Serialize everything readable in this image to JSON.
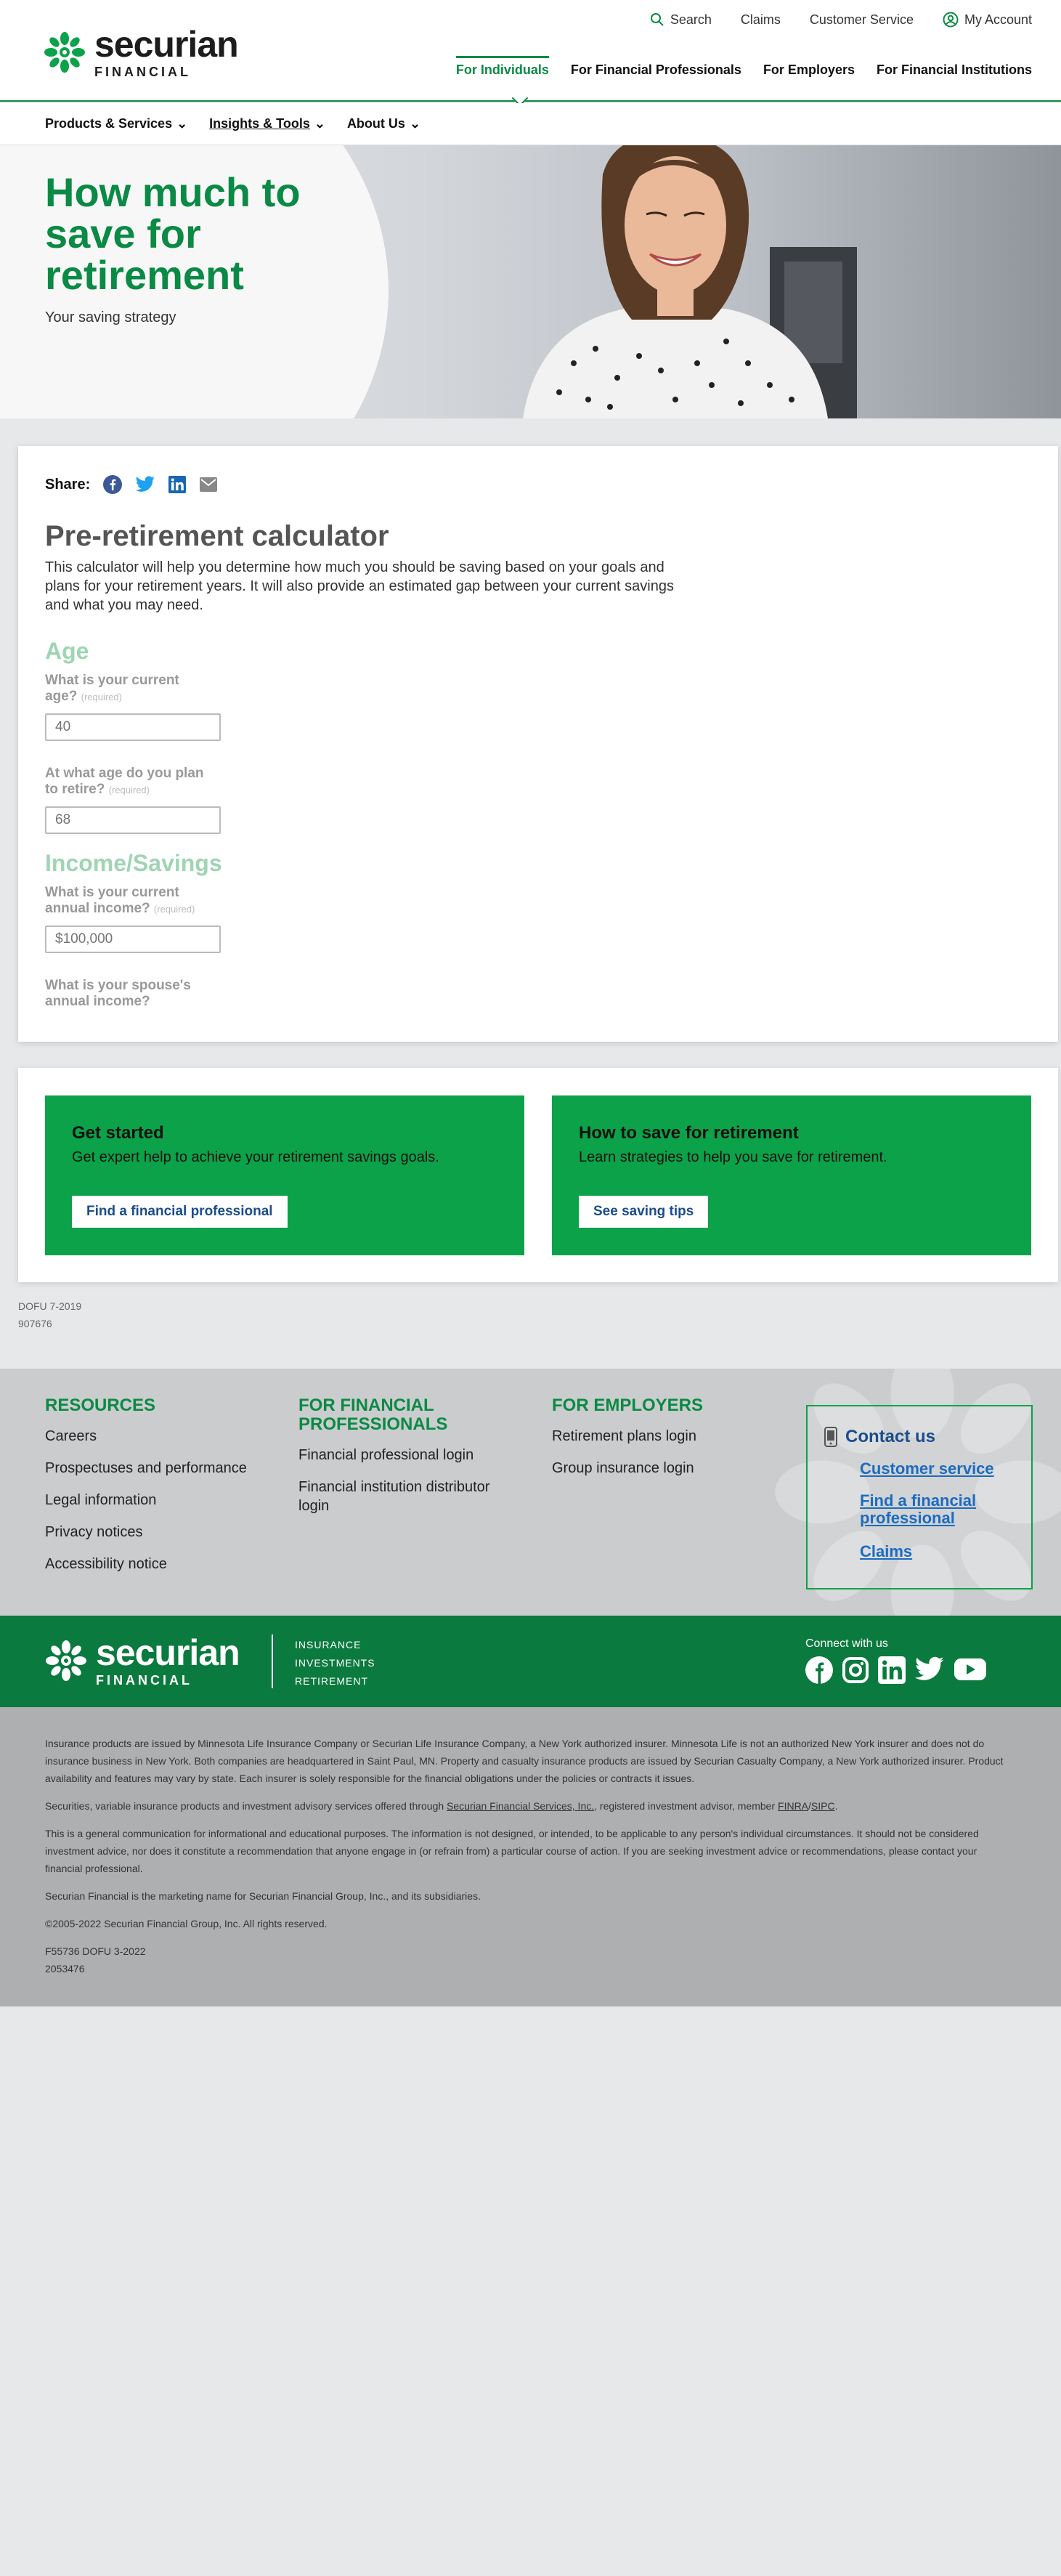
{
  "header": {
    "logo_main": "securian",
    "logo_sub": "FINANCIAL",
    "util_nav": [
      "Search",
      "Claims",
      "Customer Service",
      "My Account"
    ],
    "audience_nav": [
      "For Individuals",
      "For Financial Professionals",
      "For Employers",
      "For Financial Institutions"
    ],
    "sub_nav": [
      "Products & Services",
      "Insights & Tools",
      "About Us"
    ]
  },
  "hero": {
    "title": "How much to save for retirement",
    "subtitle": "Your saving strategy"
  },
  "calculator": {
    "share_label": "Share:",
    "share_icons": [
      "facebook-icon",
      "twitter-icon",
      "linkedin-icon",
      "email-icon"
    ],
    "title": "Pre-retirement calculator",
    "description": "This calculator will help you determine how much you should be saving based on your goals and plans for your retirement years. It will also provide an estimated gap between your current savings and what you may need.",
    "section_age": "Age",
    "q_current_age": "What is your current age?",
    "q_retire_age": "At what age do you plan to retire?",
    "required": "(required)",
    "current_age_placeholder": "40",
    "retire_age_placeholder": "68",
    "section_income": "Income/Savings",
    "q_income": "What is your current annual income?",
    "income_placeholder": "$100,000",
    "q_spouse_income": "What is your spouse's annual income?"
  },
  "cta": [
    {
      "title": "Get started",
      "text": "Get expert help to achieve your retirement savings goals.",
      "button": "Find a financial professional"
    },
    {
      "title": "How to save for retirement",
      "text": "Learn strategies to help you save for retirement.",
      "button": "See saving tips"
    }
  ],
  "codes": [
    "DOFU 7-2019",
    "907676"
  ],
  "footer": {
    "resources_title": "RESOURCES",
    "resources": [
      "Careers",
      "Prospectuses and performance",
      "Legal information",
      "Privacy notices",
      "Accessibility notice"
    ],
    "fp_title": "FOR FINANCIAL PROFESSIONALS",
    "fp_links": [
      "Financial professional login",
      "Financial institution distributor login"
    ],
    "emp_title": "FOR EMPLOYERS",
    "emp_links": [
      "Retirement plans login",
      "Group insurance login"
    ],
    "contact_title": "Contact us",
    "contact_links": [
      "Customer service",
      "Find a financial professional",
      "Claims"
    ]
  },
  "brand": {
    "lines": [
      "INSURANCE",
      "INVESTMENTS",
      "RETIREMENT"
    ],
    "connect": "Connect with us"
  },
  "legal": {
    "p1": "Insurance products are issued by Minnesota Life Insurance Company or Securian Life Insurance Company, a New York authorized insurer. Minnesota Life is not an authorized New York insurer and does not do insurance business in New York. Both companies are headquartered in Saint Paul, MN. Property and casualty insurance products are issued by Securian Casualty Company, a New York authorized insurer. Product availability and features may vary by state. Each insurer is solely responsible for the financial obligations under the policies or contracts it issues.",
    "p2_a": "Securities, variable insurance products and investment advisory services offered through ",
    "p2_link": "Securian Financial Services, Inc.",
    "p2_b": ", registered investment advisor, member ",
    "p2_finra": "FINRA",
    "p2_sep": "/",
    "p2_sipc": "SIPC",
    "p2_c": ".",
    "p3": "This is a general communication for informational and educational purposes. The information is not designed, or intended, to be applicable to any person's individual circumstances. It should not be considered investment advice, nor does it constitute a recommendation that anyone engage in (or refrain from) a particular course of action. If you are seeking investment advice or recommendations, please contact your financial professional.",
    "p4": "Securian Financial is the marketing name for Securian Financial Group, Inc., and its subsidiaries.",
    "p5": "©2005-2022 Securian Financial Group, Inc. All rights reserved.",
    "p6a": "F55736 DOFU 3-2022",
    "p6b": "2053476"
  }
}
